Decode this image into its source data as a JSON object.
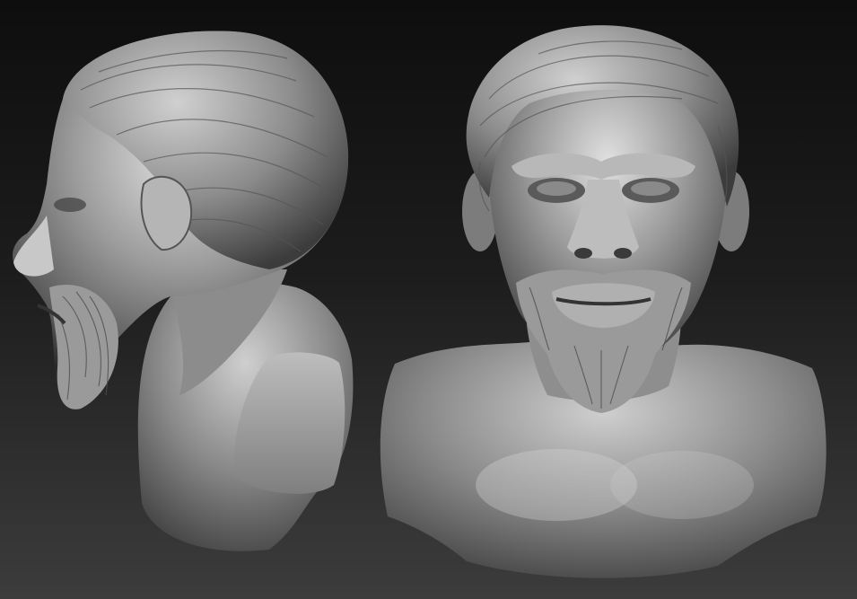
{
  "scene": {
    "background_top": "#0e0e0e",
    "background_bottom": "#3c3c3c",
    "material_color": "#9a9a9a",
    "objects": [
      {
        "name": "bust-side-view",
        "view": "left profile"
      },
      {
        "name": "bust-front-view",
        "view": "front"
      }
    ]
  }
}
